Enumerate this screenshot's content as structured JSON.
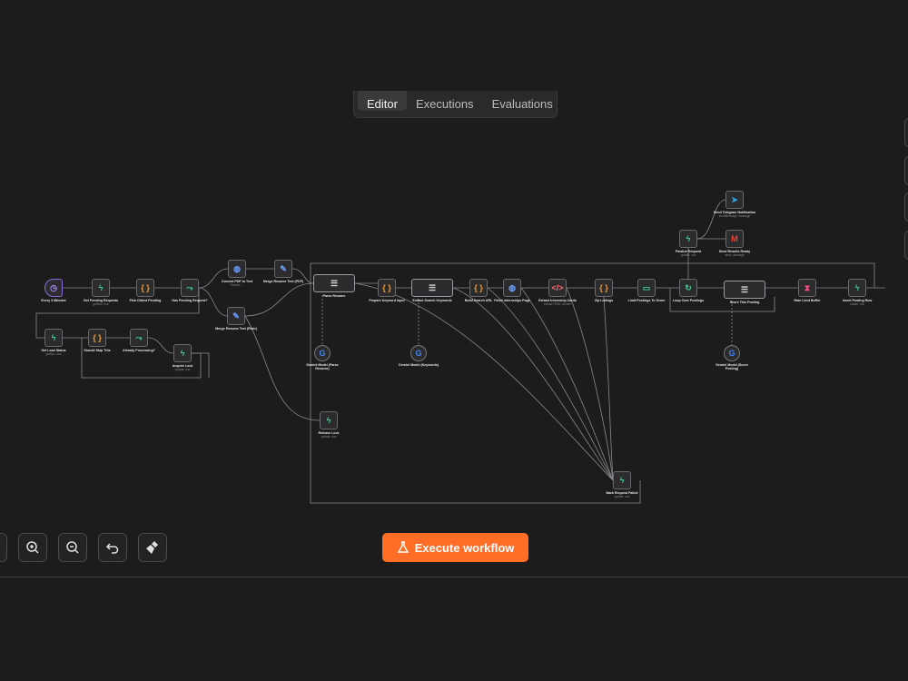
{
  "tabs": [
    {
      "label": "Editor",
      "active": true
    },
    {
      "label": "Executions",
      "active": false
    },
    {
      "label": "Evaluations",
      "active": false
    }
  ],
  "execute_label": "Execute workflow",
  "colors": {
    "accent": "#ff6d26",
    "background": "#1c1c1d",
    "node": "#2c2c2e"
  },
  "toolbar": [
    "fit-view-icon",
    "zoom-in-icon",
    "zoom-out-icon",
    "undo-icon",
    "clean-up-icon"
  ],
  "nodes": [
    {
      "id": "every3",
      "label": "Every 3 Minutes",
      "sub": "",
      "icon": "clock-icon",
      "c": "#b58cff",
      "cls": "trigger"
    },
    {
      "id": "getpend",
      "label": "Get Pending Requests",
      "sub": "getRpc: row",
      "icon": "bolt-icon",
      "c": "#3ecf8e"
    },
    {
      "id": "pickold",
      "label": "Pick Oldest Pending",
      "sub": "",
      "icon": "braces-icon",
      "c": "#f0a030"
    },
    {
      "id": "ifnosteps",
      "label": "Has Pending Request?",
      "sub": "",
      "icon": "branch-icon",
      "c": "#3ecf8e"
    },
    {
      "id": "pdf1",
      "label": "Convert PDF to Text",
      "sub": "Extract: ...",
      "icon": "globe-icon",
      "c": "#6aa0ff"
    },
    {
      "id": "merge1",
      "label": "Merge Resume Text (PDF)",
      "sub": "",
      "icon": "edit-icon",
      "c": "#6aa0ff"
    },
    {
      "id": "merge2",
      "label": "Merge Resume Text (Plain)",
      "sub": "",
      "icon": "edit-icon",
      "c": "#6aa0ff"
    },
    {
      "id": "getlead",
      "label": "Get Lead Status",
      "sub": "getRpc: row",
      "icon": "bolt-icon",
      "c": "#3ecf8e"
    },
    {
      "id": "skip",
      "label": "Should Skip This",
      "sub": "",
      "icon": "braces-icon",
      "c": "#f0a030"
    },
    {
      "id": "already",
      "label": "Already Processing?",
      "sub": "",
      "icon": "branch-icon",
      "c": "#3ecf8e"
    },
    {
      "id": "acquire",
      "label": "Acquire Lock",
      "sub": "update: row",
      "icon": "bolt-icon",
      "c": "#3ecf8e"
    },
    {
      "id": "parse",
      "label": "Parse Resume",
      "sub": "",
      "icon": "ai-agent-icon",
      "c": "#d0d0d0",
      "cls": "wide"
    },
    {
      "id": "gem1",
      "label": "Gemini Model (Parse Resume)",
      "sub": "",
      "icon": "google-icon",
      "c": "#4285f4",
      "cls": "round"
    },
    {
      "id": "prepkey",
      "label": "Prepare Keyword Input",
      "sub": "",
      "icon": "braces-icon",
      "c": "#f0a030"
    },
    {
      "id": "extract",
      "label": "Extract Search Keywords",
      "sub": "",
      "icon": "ai-agent-icon",
      "c": "#d0d0d0",
      "cls": "wide"
    },
    {
      "id": "gem2",
      "label": "Gemini Model (Keywords)",
      "sub": "",
      "icon": "google-icon",
      "c": "#4285f4",
      "cls": "round"
    },
    {
      "id": "build",
      "label": "Build Search URL",
      "sub": "",
      "icon": "braces-icon",
      "c": "#f0a030"
    },
    {
      "id": "fetch",
      "label": "Fetch Internships Page",
      "sub": "",
      "icon": "globe-icon",
      "c": "#6aa0ff"
    },
    {
      "id": "extcard",
      "label": "Extract Internship Cards",
      "sub": "extract HTML content",
      "icon": "code-icon",
      "c": "#ff6d6d"
    },
    {
      "id": "zip",
      "label": "Zip Listings",
      "sub": "",
      "icon": "braces-icon",
      "c": "#f0a030"
    },
    {
      "id": "limit",
      "label": "Limit Postings To Score",
      "sub": "",
      "icon": "limit-icon",
      "c": "#3ecf8e"
    },
    {
      "id": "loop",
      "label": "Loop Over Postings",
      "sub": "",
      "icon": "loop-icon",
      "c": "#3ecf8e"
    },
    {
      "id": "finalize",
      "label": "Finalize Request",
      "sub": "update: row",
      "icon": "bolt-icon",
      "c": "#3ecf8e"
    },
    {
      "id": "telegram",
      "label": "Send Telegram Notification",
      "sub": "sendMessage: message",
      "icon": "telegram-icon",
      "c": "#2aa3e0"
    },
    {
      "id": "gmail",
      "label": "Send Results Ready",
      "sub": "send: message",
      "icon": "gmail-icon",
      "c": "#ea4335"
    },
    {
      "id": "score",
      "label": "Score This Posting",
      "sub": "",
      "icon": "ai-agent-icon",
      "c": "#d0d0d0",
      "cls": "wide"
    },
    {
      "id": "gem3",
      "label": "Gemini Model (Score Posting)",
      "sub": "",
      "icon": "google-icon",
      "c": "#4285f4",
      "cls": "round"
    },
    {
      "id": "rate",
      "label": "Rate Limit Buffer",
      "sub": "",
      "icon": "hourglass-icon",
      "c": "#ff4d88"
    },
    {
      "id": "insert",
      "label": "Insert Posting Row",
      "sub": "create: row",
      "icon": "bolt-icon",
      "c": "#3ecf8e"
    },
    {
      "id": "release",
      "label": "Release Lock",
      "sub": "update: row",
      "icon": "bolt-icon",
      "c": "#3ecf8e"
    },
    {
      "id": "failed",
      "label": "Mark Request Failed",
      "sub": "update: row",
      "icon": "bolt-icon",
      "c": "#3ecf8e"
    }
  ]
}
